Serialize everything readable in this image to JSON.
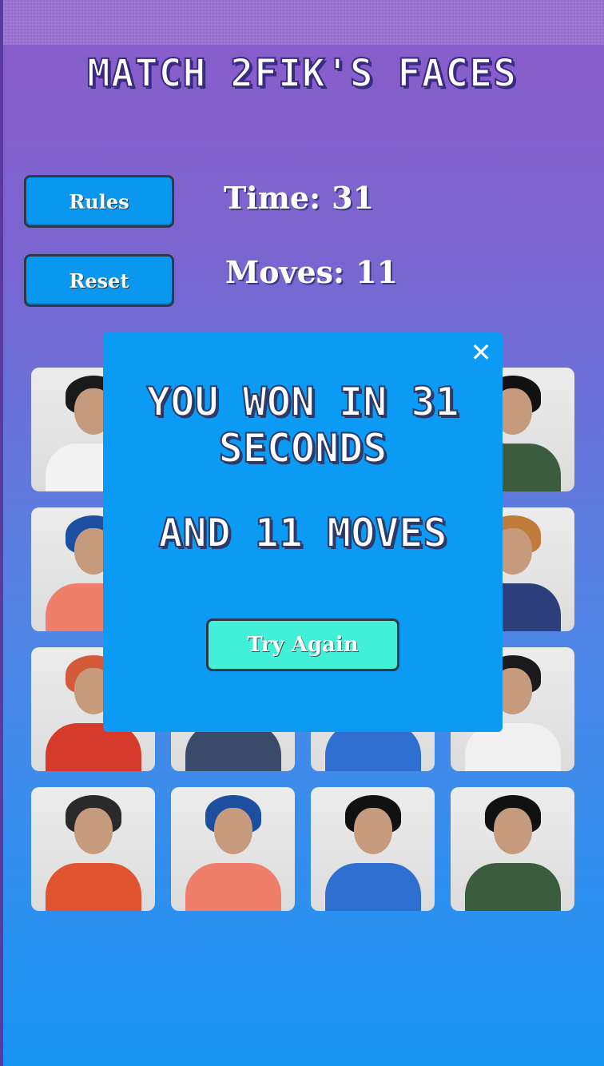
{
  "app": {
    "title": "Match 2Fik's faces"
  },
  "controls": {
    "rules_label": "Rules",
    "reset_label": "Reset"
  },
  "stats": {
    "time_label": "Time:",
    "time_value": "31",
    "moves_label": "Moves:",
    "moves_value": "11"
  },
  "dialog": {
    "line1": "You won in 31 seconds",
    "line2": "and 11 moves",
    "close_icon": "close-icon",
    "try_again_label": "Try Again"
  },
  "cards": [
    {
      "hair": "#1a1a1a",
      "body": "#f2f2f2"
    },
    {
      "hair": "#1a1a1a",
      "body": "#3e6b4a"
    },
    {
      "hair": "#1a1a1a",
      "body": "#2f3c6a"
    },
    {
      "hair": "#111111",
      "body": "#3b5d3e"
    },
    {
      "hair": "#1c4fa0",
      "body": "#ef7f6a"
    },
    {
      "hair": "#6a4a3a",
      "body": "#3c4fa0"
    },
    {
      "hair": "#111111",
      "body": "#2f6fd0"
    },
    {
      "hair": "#c07a3a",
      "body": "#2c3f7a"
    },
    {
      "hair": "#d45a3a",
      "body": "#d53a2a"
    },
    {
      "hair": "#1a1a1a",
      "body": "#3a4a6a"
    },
    {
      "hair": "#111111",
      "body": "#2f6fd0"
    },
    {
      "hair": "#1a1a1a",
      "body": "#f0f0f0"
    },
    {
      "hair": "#2a2a2a",
      "body": "#e0552f"
    },
    {
      "hair": "#1c4fa0",
      "body": "#ef7f6a"
    },
    {
      "hair": "#111111",
      "body": "#2f6fd0"
    },
    {
      "hair": "#111111",
      "body": "#3b5d3e"
    }
  ]
}
